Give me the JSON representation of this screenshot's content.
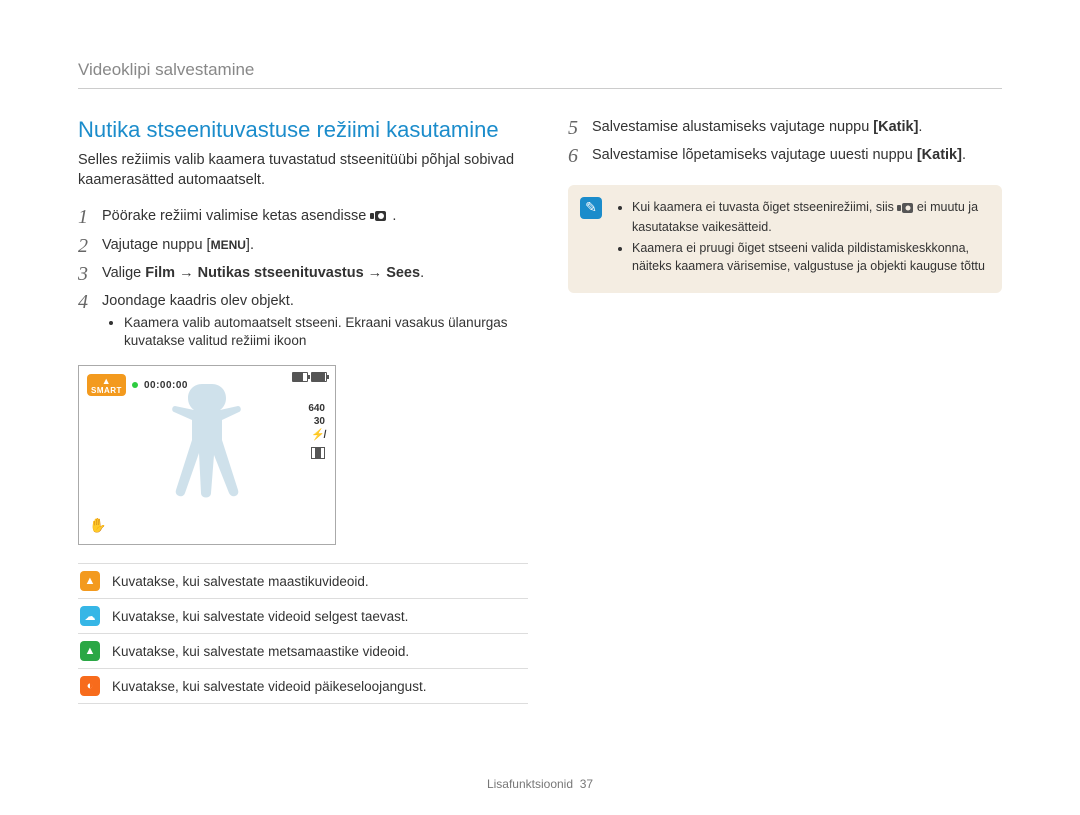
{
  "page_header": "Videoklipi salvestamine",
  "section_title": "Nutika stseenituvastuse režiimi kasutamine",
  "intro": "Selles režiimis valib kaamera tuvastatud stseenitüübi põhjal sobivad kaamerasätted automaatselt.",
  "steps_left": {
    "1": "Pöörake režiimi valimise ketas asendisse ",
    "1_tail": ".",
    "2_pre": "Vajutage nuppu [",
    "2_menu": "MENU",
    "2_post": "].",
    "3_pre": "Valige ",
    "3_bold": "Film → Nutikas stseenituvastus → Sees",
    "3_post": ".",
    "4": "Joondage kaadris olev objekt.",
    "4_bullet": "Kaamera valib automaatselt stseeni. Ekraani vasakus ülanurgas kuvatakse valitud režiimi ikoon"
  },
  "steps_right": {
    "5_pre": "Salvestamise alustamiseks vajutage nuppu ",
    "5_bold": "[Katik]",
    "5_post": ".",
    "6_pre": "Salvestamise lõpetamiseks vajutage uuesti nuppu ",
    "6_bold": "[Katik]",
    "6_post": "."
  },
  "lcd": {
    "mode_label": "SMART",
    "timer": "00:00:00",
    "res": "640",
    "fps": "30"
  },
  "icon_rows": [
    "Kuvatakse, kui salvestate maastikuvideoid.",
    "Kuvatakse, kui salvestate videoid selgest taevast.",
    "Kuvatakse, kui salvestate metsamaastike videoid.",
    "Kuvatakse, kui salvestate videoid päikeseloojangust."
  ],
  "note_items": [
    "Kui kaamera ei tuvasta õiget stseenirežiimi, siis      ei muutu ja kasutatakse vaikesätteid.",
    "Kaamera ei pruugi õiget stseeni valida pildistamiskeskkonna, näiteks kaamera värisemise, valgustuse ja objekti kauguse tõttu"
  ],
  "footer_label": "Lisafunktsioonid",
  "footer_page": "37"
}
